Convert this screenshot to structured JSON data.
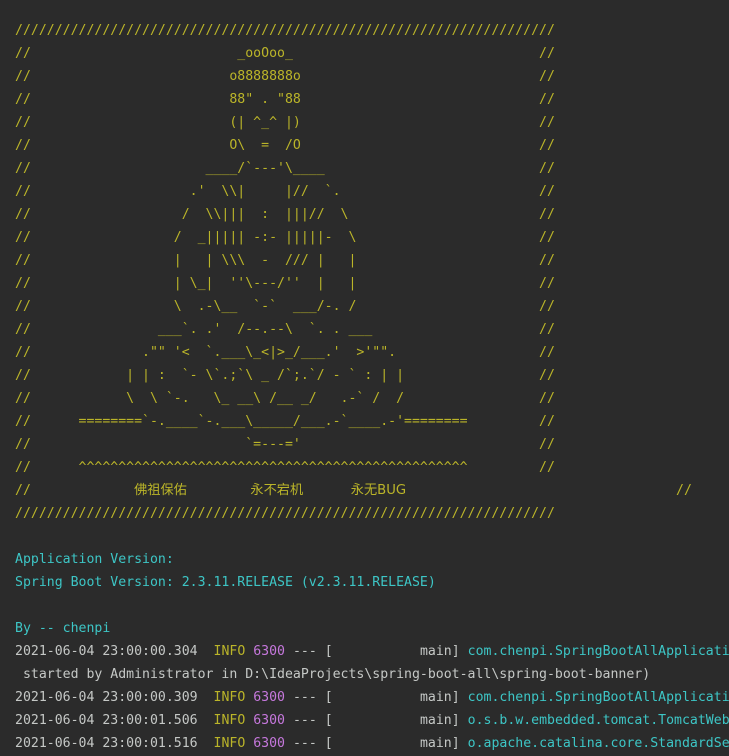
{
  "banner": {
    "lines": [
      "////////////////////////////////////////////////////////////////////",
      "//                          _ooOoo_                               //",
      "//                         o8888888o                              //",
      "//                         88\" . \"88                              //",
      "//                         (| ^_^ |)                              //",
      "//                         O\\  =  /O                              //",
      "//                      ____/`---'\\____                           //",
      "//                    .'  \\\\|     |//  `.                         //",
      "//                   /  \\\\|||  :  |||//  \\                        //",
      "//                  /  _||||| -:- |||||-  \\                       //",
      "//                  |   | \\\\\\  -  /// |   |                       //",
      "//                  | \\_|  ''\\---/''  |   |                       //",
      "//                  \\  .-\\__  `-`  ___/-. /                       //",
      "//                ___`. .'  /--.--\\  `. . ___                     //",
      "//              .\"\" '<  `.___\\_<|>_/___.'  >'\"\".                  //",
      "//            | | :  `- \\`.;`\\ _ /`;.`/ - ` : | |                 //",
      "//            \\  \\ `-.   \\_ __\\ /__ _/   .-` /  /                 //",
      "//      ========`-.____`-.___\\_____/___.-`____.-'========         //",
      "//                           `=---='                              //",
      "//      ^^^^^^^^^^^^^^^^^^^^^^^^^^^^^^^^^^^^^^^^^^^^^^^^^         //"
    ],
    "blessing": {
      "prefix": "//",
      "gap1": "             ",
      "item1": "佛祖保佑",
      "gap2": "        ",
      "item2": "永不宕机",
      "gap3": "      ",
      "item3": "永无BUG",
      "suffix": "//"
    },
    "bottom_border": "////////////////////////////////////////////////////////////////////"
  },
  "app_info": {
    "application_version": "Application Version:",
    "spring_boot_version": "Spring Boot Version: 2.3.11.RELEASE (v2.3.11.RELEASE)"
  },
  "author_line": "By -- chenpi",
  "logs": [
    {
      "timestamp": "2021-06-04 23:00:00.304",
      "level": "INFO",
      "pid": "6300",
      "sep": " --- [",
      "thread": "           main] ",
      "logger": "com.chenpi.SpringBootAllApplication"
    },
    {
      "text": " started by Administrator in D:\\IdeaProjects\\spring-boot-all\\spring-boot-banner)"
    },
    {
      "timestamp": "2021-06-04 23:00:00.309",
      "level": "INFO",
      "pid": "6300",
      "sep": " --- [",
      "thread": "           main] ",
      "logger": "com.chenpi.SpringBootAllApplication"
    },
    {
      "timestamp": "2021-06-04 23:00:01.506",
      "level": "INFO",
      "pid": "6300",
      "sep": " --- [",
      "thread": "           main] ",
      "logger": "o.s.b.w.embedded.tomcat.TomcatWebServer"
    },
    {
      "timestamp": "2021-06-04 23:00:01.516",
      "level": "INFO",
      "pid": "6300",
      "sep": " --- [",
      "thread": "           main] ",
      "logger": "o.apache.catalina.core.StandardService"
    }
  ]
}
